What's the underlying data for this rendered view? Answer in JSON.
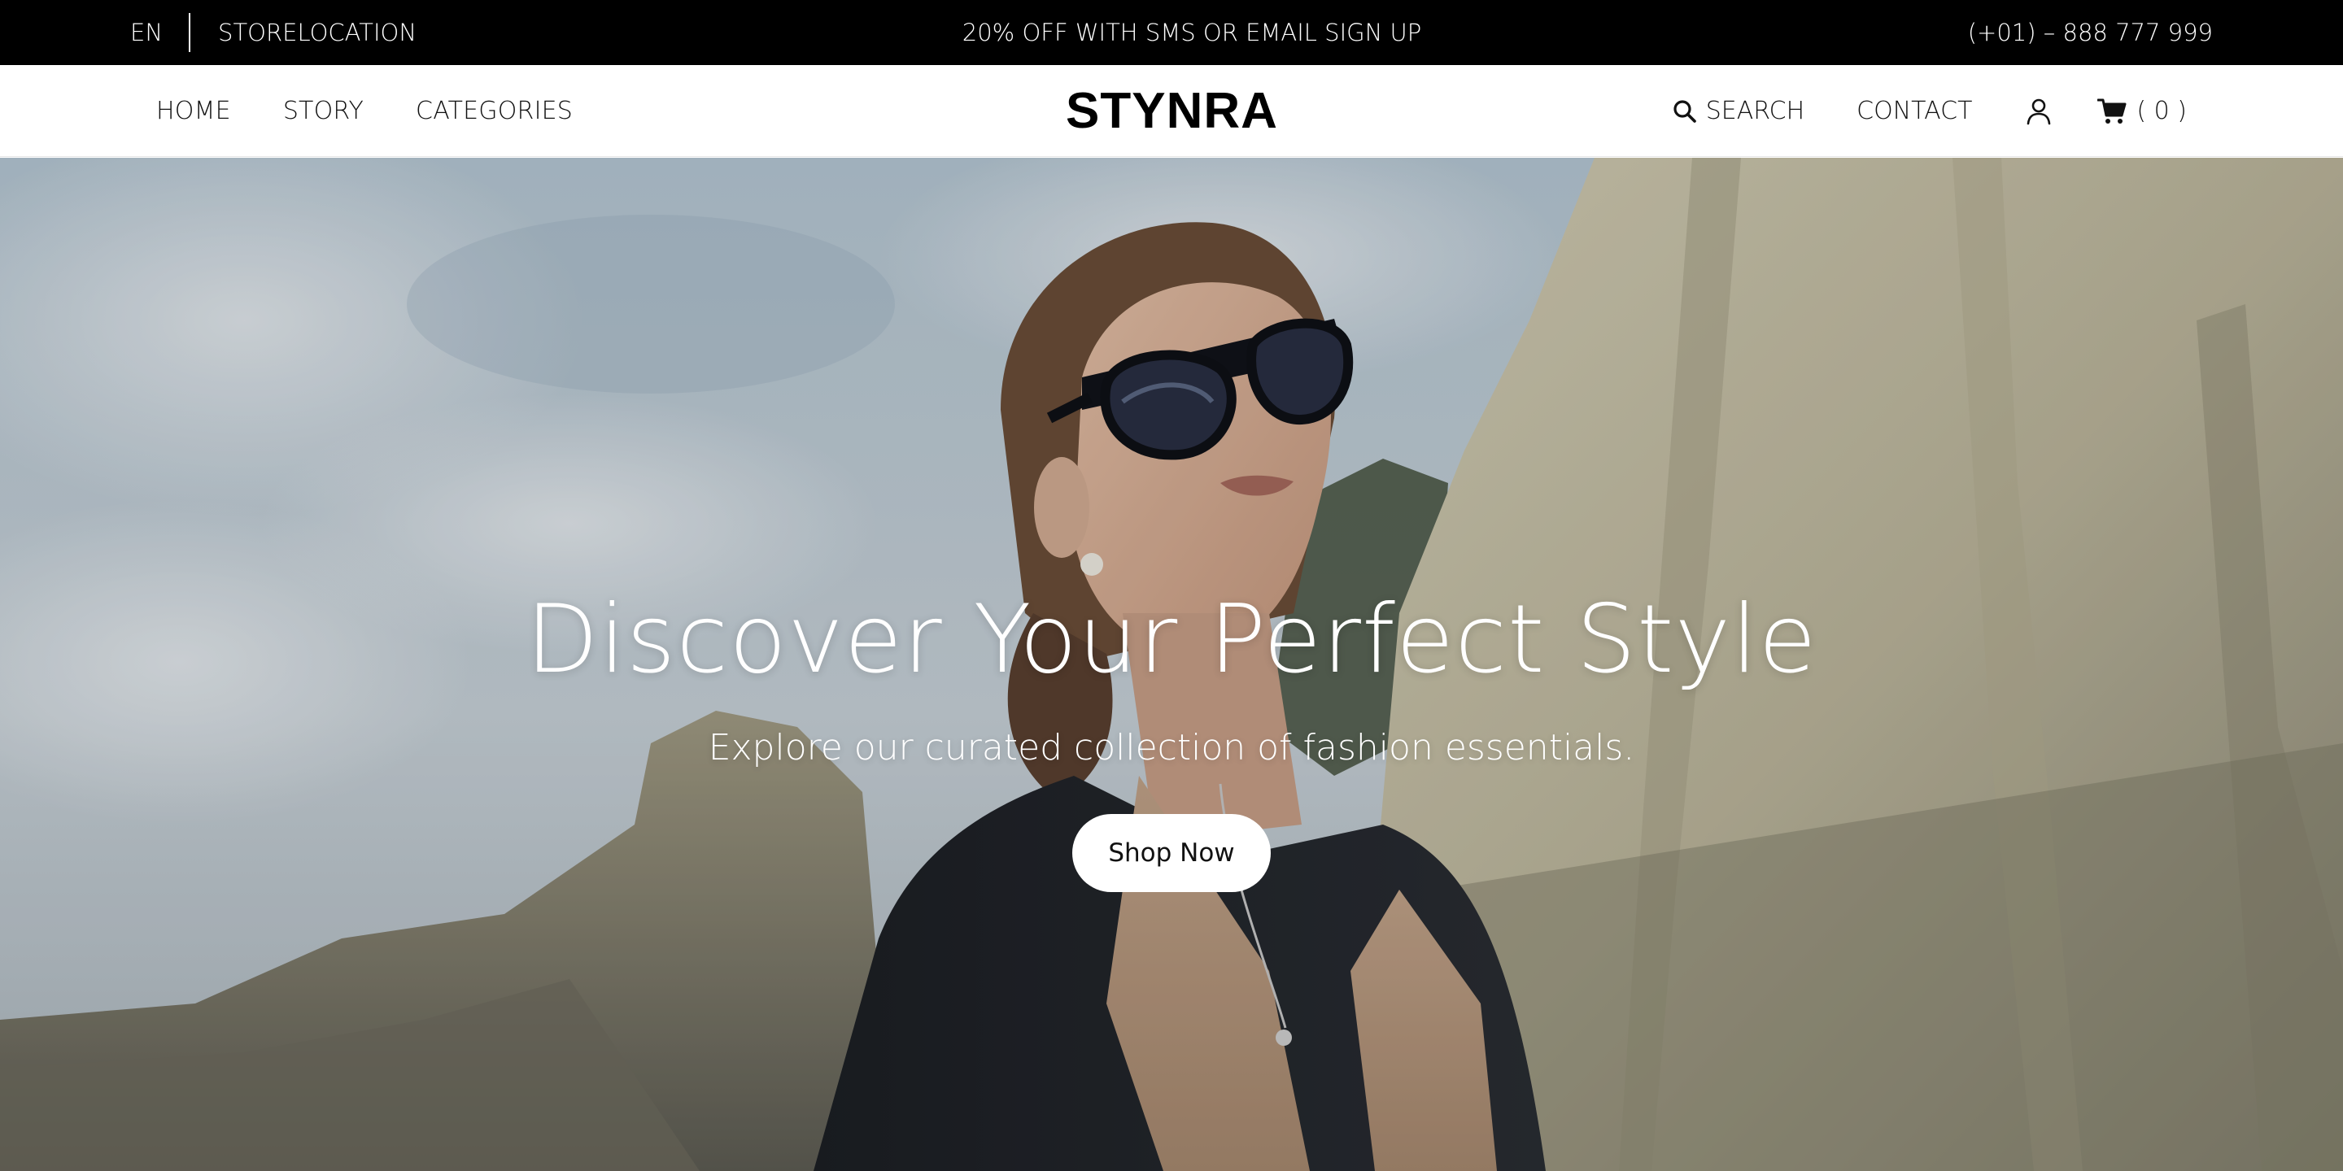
{
  "topbar": {
    "language": "EN",
    "store_location": "STORELOCATION",
    "promo": "20% OFF WITH SMS OR EMAIL SIGN UP",
    "phone": "(+01) – 888 777 999"
  },
  "nav": {
    "menu": [
      "HOME",
      "STORY",
      "CATEGORIES"
    ],
    "logo": "STYNRA",
    "search_label": "SEARCH",
    "contact_label": "CONTACT",
    "cart_count": "( 0 )",
    "icons": {
      "search": "search-icon",
      "user": "user-icon",
      "cart": "cart-icon"
    }
  },
  "hero": {
    "title": "Discover Your Perfect Style",
    "subtitle": "Explore our curated collection of fashion essentials.",
    "cta": "Shop Now"
  },
  "colors": {
    "topbar_bg": "#000000",
    "nav_bg": "#ffffff",
    "text_dark": "#111111",
    "hero_text": "#ffffff",
    "button_bg": "#ffffff"
  }
}
